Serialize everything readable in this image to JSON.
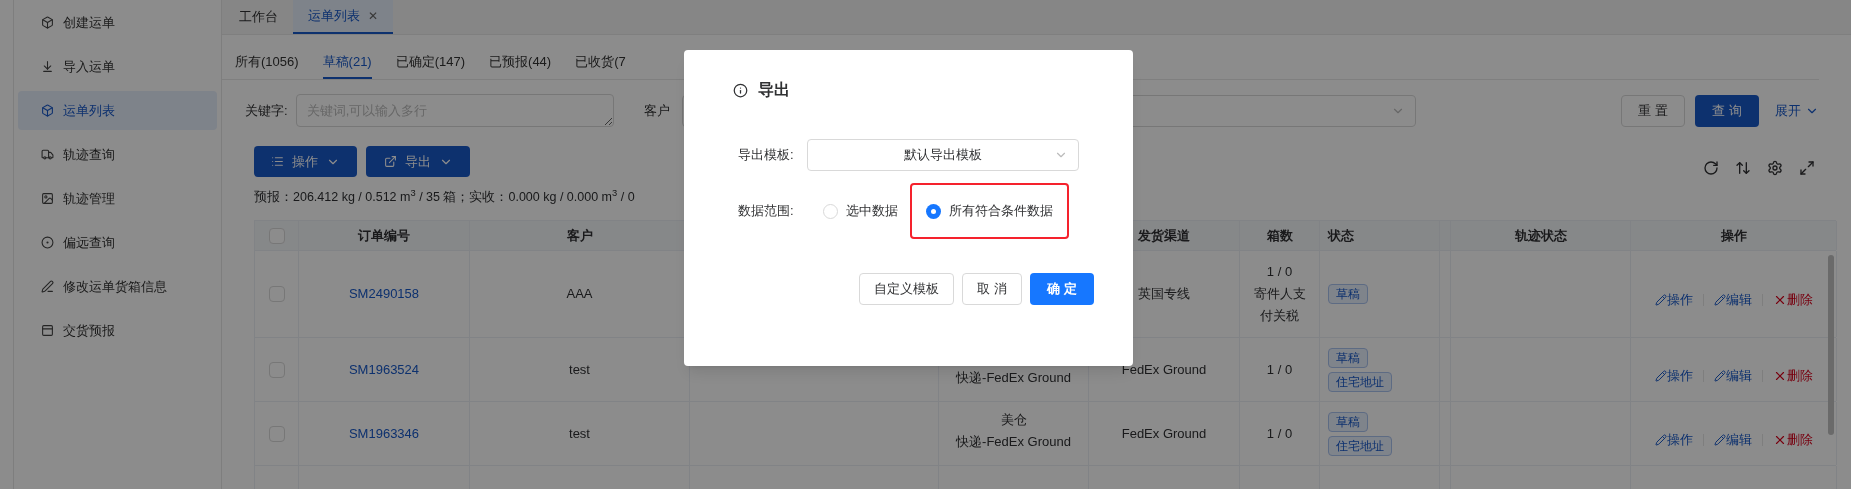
{
  "sidebar": {
    "items": [
      {
        "label": "创建运单",
        "selected": false
      },
      {
        "label": "导入运单",
        "selected": false
      },
      {
        "label": "运单列表",
        "selected": true
      },
      {
        "label": "轨迹查询",
        "selected": false
      },
      {
        "label": "轨迹管理",
        "selected": false
      },
      {
        "label": "偏远查询",
        "selected": false
      },
      {
        "label": "修改运单货箱信息",
        "selected": false
      },
      {
        "label": "交货预报",
        "selected": false
      }
    ]
  },
  "page_tabs": [
    {
      "label": "工作台",
      "selected": false,
      "closable": false
    },
    {
      "label": "运单列表",
      "selected": true,
      "closable": true
    }
  ],
  "close_glyph": "✕",
  "status_tabs": [
    {
      "label": "所有(1056)",
      "selected": false
    },
    {
      "label": "草稿(21)",
      "selected": true
    },
    {
      "label": "已确定(147)",
      "selected": false
    },
    {
      "label": "已预报(44)",
      "selected": false
    },
    {
      "label": "已收货(7",
      "selected": false
    }
  ],
  "filters": {
    "keyword_label": "关键字:",
    "keyword_placeholder": "关键词,可以输入多行",
    "customer_label": "客户",
    "reset": "重 置",
    "search": "查 询",
    "expand": "展开"
  },
  "toolbar": {
    "operate": "操作",
    "export": "导出"
  },
  "summary": "预报：206.412 kg / 0.512 m$^{3}$ / 35 箱；实收：0.000 kg / 0.000 m$^{3}$ / 0",
  "table": {
    "header": {
      "checked": false,
      "order_no": "订单编号",
      "customer": "客户",
      "channel": "发货渠道",
      "boxes": "箱数",
      "status": "状态",
      "track_status": "轨迹状态",
      "actions": "操作"
    },
    "rows": [
      {
        "checked": false,
        "order_no": "SM2490158",
        "customer": "AAA",
        "column_5": [],
        "channel": "英国专线",
        "boxes": [
          "1 / 0",
          "寄件人支付关税"
        ],
        "statuses": [
          "草稿"
        ],
        "actions": [
          {
            "kind": "edit",
            "label": "操作"
          },
          {
            "kind": "edit",
            "label": "编辑"
          },
          {
            "kind": "delete",
            "label": "删除"
          }
        ]
      },
      {
        "checked": false,
        "order_no": "SM1963524",
        "customer": "test",
        "column_5": [
          "快递-FedEx Ground"
        ],
        "channel": "FedEx Ground",
        "boxes": [
          "1 / 0"
        ],
        "statuses": [
          "草稿",
          "住宅地址"
        ],
        "actions": [
          {
            "kind": "edit",
            "label": "操作"
          },
          {
            "kind": "edit",
            "label": "编辑"
          },
          {
            "kind": "delete",
            "label": "删除"
          }
        ]
      },
      {
        "checked": false,
        "order_no": "SM1963346",
        "customer": "test",
        "column_5": [
          "美仓",
          "快递-FedEx Ground"
        ],
        "channel": "FedEx Ground",
        "boxes": [
          "1 / 0"
        ],
        "statuses": [
          "草稿",
          "住宅地址"
        ],
        "actions": [
          {
            "kind": "edit",
            "label": "操作"
          },
          {
            "kind": "edit",
            "label": "编辑"
          },
          {
            "kind": "delete",
            "label": "删除"
          }
        ]
      }
    ]
  },
  "dialog": {
    "title": "导出",
    "template_label": "导出模板:",
    "template_value": "默认导出模板",
    "range_label": "数据范围:",
    "range_options": [
      {
        "label": "选中数据",
        "selected": false,
        "highlighted": false
      },
      {
        "label": "所有符合条件数据",
        "selected": true,
        "highlighted": true
      }
    ],
    "buttons": [
      {
        "kind": "default",
        "label": "自定义模板"
      },
      {
        "kind": "default",
        "label": "取 消"
      },
      {
        "kind": "primary",
        "label": "确 定"
      }
    ]
  }
}
